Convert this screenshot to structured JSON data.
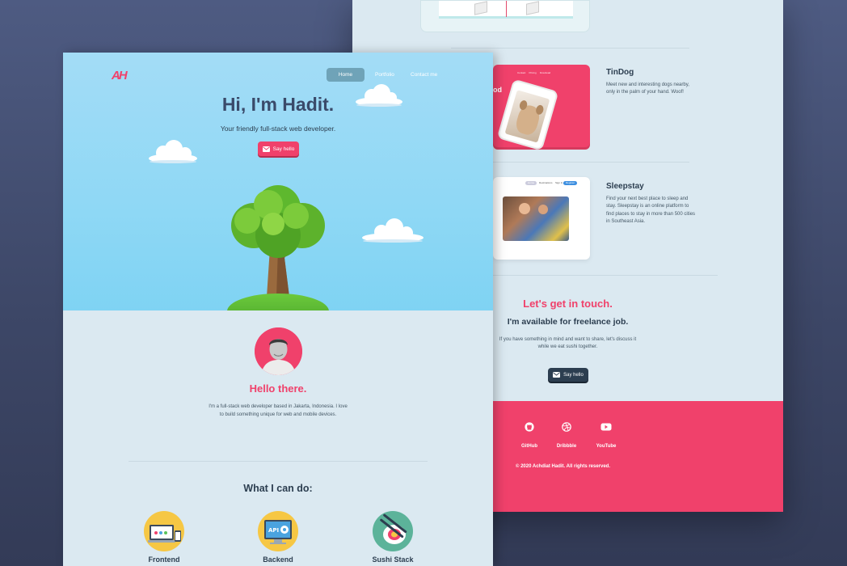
{
  "front": {
    "logo": "AH",
    "nav": {
      "home": "Home",
      "portfolio": "Portfolio",
      "contact": "Contact me"
    },
    "hero": {
      "title": "Hi, I'm Hadit.",
      "subtitle": "Your friendly full-stack web developer.",
      "button": "Say hello"
    },
    "about": {
      "heading": "Hello there.",
      "description": "I'm a full-stack web developer based in Jakarta, Indonesia. I love to build something unique for web and mobile devices."
    },
    "skills": {
      "heading": "What I can do:",
      "items": [
        {
          "label": "Frontend",
          "icon": "frontend-devices-icon"
        },
        {
          "label": "Backend",
          "icon": "api-gear-icon"
        },
        {
          "label": "Sushi Stack",
          "icon": "sushi-icon"
        }
      ]
    }
  },
  "back": {
    "projects": [
      {
        "title": "TinDog",
        "description": "Meet new and interesting dogs nearby, only in the palm of your hand. Woof!",
        "card_nav": [
          "Contact",
          "Pricing",
          "Download"
        ],
        "card_text": "od"
      },
      {
        "title": "Sleepstay",
        "description": "Find your next best place to sleep and stay. Sleepstay is an online platform to find places to stay in more than 500 cities in Southeast Asia.",
        "card_nav": [
          "Home",
          "Destinations",
          "Sign In",
          "Register"
        ]
      }
    ],
    "contact": {
      "heading": "Let's get in touch.",
      "subheading": "I'm available for freelance job.",
      "description": "If you have something in mind and want to share, let's discuss it while we eat sushi together.",
      "button": "Say hello"
    },
    "footer": {
      "links": [
        {
          "label": "GitHub",
          "icon": "github-icon"
        },
        {
          "label": "Dribbble",
          "icon": "dribbble-icon"
        },
        {
          "label": "YouTube",
          "icon": "youtube-icon"
        }
      ],
      "copyright": "© 2020 Achdiat Hadit. All rights reserved."
    }
  },
  "colors": {
    "accent": "#f0416b",
    "dark": "#2c3e50",
    "sky": "#8fd8f5",
    "page_bg": "#dbe9f1"
  }
}
